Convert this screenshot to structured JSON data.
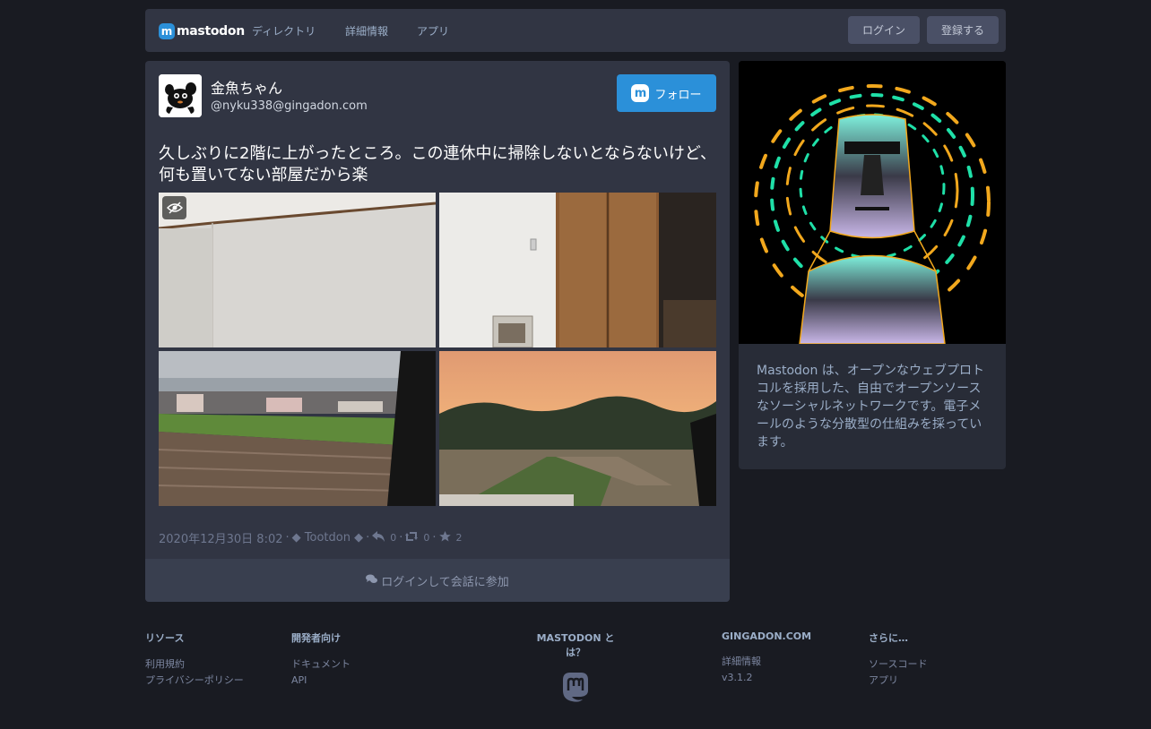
{
  "header": {
    "logo_text": "mastodon",
    "nav": [
      "ディレクトリ",
      "詳細情報",
      "アプリ"
    ],
    "login_label": "ログイン",
    "register_label": "登録する"
  },
  "status": {
    "display_name": "金魚ちゃん",
    "acct": "@nyku338@gingadon.com",
    "follow_label": "フォロー",
    "content": "久しぶりに2階に上がったところ。この連休中に掃除しないとならないけど、何も置いてない部屋だから楽",
    "timestamp": "2020年12月30日 8:02",
    "application": "◆ Tootdon ◆",
    "replies": "0",
    "boosts": "0",
    "favourites": "2",
    "join_label": "ログインして会話に参加"
  },
  "about": {
    "text": "Mastodon は、オープンなウェブプロトコルを採用した、自由でオープンソースなソーシャルネットワークです。電子メールのような分散型の仕組みを採っています。"
  },
  "footer": {
    "resources": {
      "title": "リソース",
      "links": [
        "利用規約",
        "プライバシーポリシー"
      ]
    },
    "developers": {
      "title": "開発者向け",
      "links": [
        "ドキュメント",
        "API"
      ]
    },
    "what_is": {
      "title": "MASTODON とは？"
    },
    "instance": {
      "title": "GINGADON.COM",
      "links": [
        "詳細情報",
        "v3.1.2"
      ]
    },
    "more": {
      "title": "さらに…",
      "links": [
        "ソースコード",
        "アプリ"
      ]
    }
  },
  "colors": {
    "background": "#191b22",
    "panel": "#313543",
    "accent": "#2b90d9",
    "muted_text": "#9baec8"
  }
}
